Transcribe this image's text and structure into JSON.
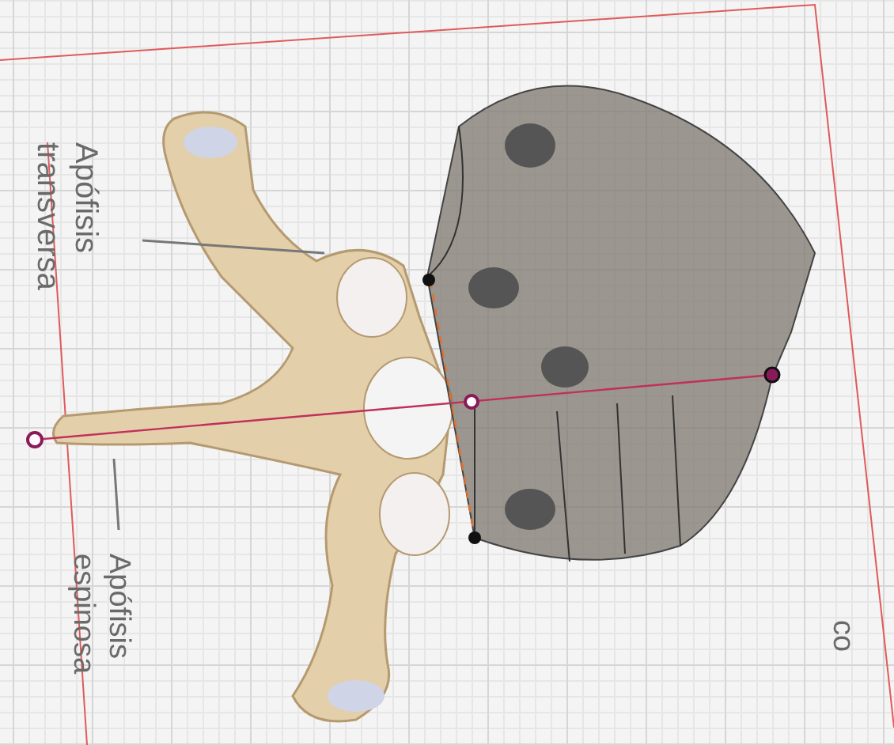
{
  "labels": [
    {
      "kind": "callout",
      "lines": [
        "Apófisis",
        "transversa"
      ]
    },
    {
      "kind": "callout",
      "lines": [
        "Apófisis",
        "espinosa"
      ]
    },
    {
      "kind": "cut",
      "lines": [
        "co"
      ]
    }
  ]
}
